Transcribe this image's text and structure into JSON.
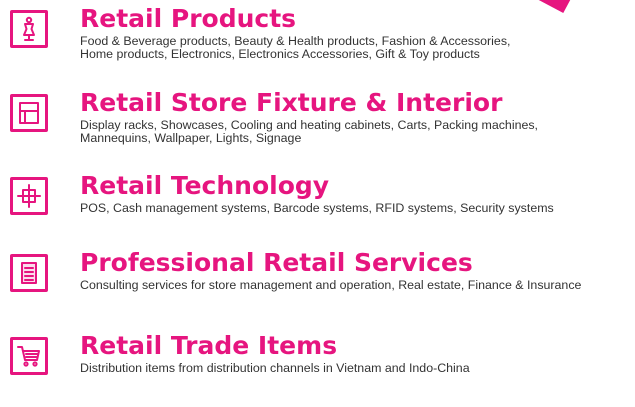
{
  "colors": {
    "accent": "#e6157f",
    "text": "#333333",
    "background": "#ffffff"
  },
  "categories": [
    {
      "icon": "mannequin-icon",
      "title": "Retail Products",
      "lines": [
        "Food & Beverage products, Beauty & Health products, Fashion & Accessories,",
        "Home products, Electronics, Electronics Accessories, Gift & Toy products"
      ]
    },
    {
      "icon": "store-fixture-icon",
      "title": "Retail Store Fixture & Interior",
      "lines": [
        "Display racks, Showcases, Cooling and heating cabinets, Carts, Packing machines,",
        "Mannequins, Wallpaper, Lights, Signage"
      ]
    },
    {
      "icon": "target-crosshair-icon",
      "title": "Retail Technology",
      "lines": [
        "POS, Cash management systems, Barcode systems, RFID systems, Security systems"
      ]
    },
    {
      "icon": "document-icon",
      "title": "Professional Retail Services",
      "lines": [
        "Consulting services for store management and operation, Real estate, Finance & Insurance"
      ]
    },
    {
      "icon": "shopping-cart-icon",
      "title": "Retail Trade Items",
      "lines": [
        "Distribution items from distribution channels in Vietnam and Indo-China"
      ]
    }
  ]
}
